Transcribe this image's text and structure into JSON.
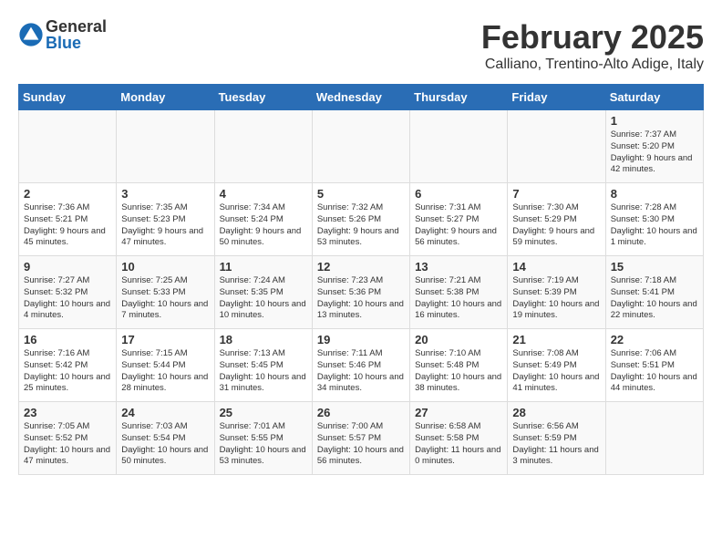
{
  "header": {
    "logo_general": "General",
    "logo_blue": "Blue",
    "month_year": "February 2025",
    "location": "Calliano, Trentino-Alto Adige, Italy"
  },
  "weekdays": [
    "Sunday",
    "Monday",
    "Tuesday",
    "Wednesday",
    "Thursday",
    "Friday",
    "Saturday"
  ],
  "weeks": [
    [
      {
        "day": "",
        "info": ""
      },
      {
        "day": "",
        "info": ""
      },
      {
        "day": "",
        "info": ""
      },
      {
        "day": "",
        "info": ""
      },
      {
        "day": "",
        "info": ""
      },
      {
        "day": "",
        "info": ""
      },
      {
        "day": "1",
        "info": "Sunrise: 7:37 AM\nSunset: 5:20 PM\nDaylight: 9 hours and 42 minutes."
      }
    ],
    [
      {
        "day": "2",
        "info": "Sunrise: 7:36 AM\nSunset: 5:21 PM\nDaylight: 9 hours and 45 minutes."
      },
      {
        "day": "3",
        "info": "Sunrise: 7:35 AM\nSunset: 5:23 PM\nDaylight: 9 hours and 47 minutes."
      },
      {
        "day": "4",
        "info": "Sunrise: 7:34 AM\nSunset: 5:24 PM\nDaylight: 9 hours and 50 minutes."
      },
      {
        "day": "5",
        "info": "Sunrise: 7:32 AM\nSunset: 5:26 PM\nDaylight: 9 hours and 53 minutes."
      },
      {
        "day": "6",
        "info": "Sunrise: 7:31 AM\nSunset: 5:27 PM\nDaylight: 9 hours and 56 minutes."
      },
      {
        "day": "7",
        "info": "Sunrise: 7:30 AM\nSunset: 5:29 PM\nDaylight: 9 hours and 59 minutes."
      },
      {
        "day": "8",
        "info": "Sunrise: 7:28 AM\nSunset: 5:30 PM\nDaylight: 10 hours and 1 minute."
      }
    ],
    [
      {
        "day": "9",
        "info": "Sunrise: 7:27 AM\nSunset: 5:32 PM\nDaylight: 10 hours and 4 minutes."
      },
      {
        "day": "10",
        "info": "Sunrise: 7:25 AM\nSunset: 5:33 PM\nDaylight: 10 hours and 7 minutes."
      },
      {
        "day": "11",
        "info": "Sunrise: 7:24 AM\nSunset: 5:35 PM\nDaylight: 10 hours and 10 minutes."
      },
      {
        "day": "12",
        "info": "Sunrise: 7:23 AM\nSunset: 5:36 PM\nDaylight: 10 hours and 13 minutes."
      },
      {
        "day": "13",
        "info": "Sunrise: 7:21 AM\nSunset: 5:38 PM\nDaylight: 10 hours and 16 minutes."
      },
      {
        "day": "14",
        "info": "Sunrise: 7:19 AM\nSunset: 5:39 PM\nDaylight: 10 hours and 19 minutes."
      },
      {
        "day": "15",
        "info": "Sunrise: 7:18 AM\nSunset: 5:41 PM\nDaylight: 10 hours and 22 minutes."
      }
    ],
    [
      {
        "day": "16",
        "info": "Sunrise: 7:16 AM\nSunset: 5:42 PM\nDaylight: 10 hours and 25 minutes."
      },
      {
        "day": "17",
        "info": "Sunrise: 7:15 AM\nSunset: 5:44 PM\nDaylight: 10 hours and 28 minutes."
      },
      {
        "day": "18",
        "info": "Sunrise: 7:13 AM\nSunset: 5:45 PM\nDaylight: 10 hours and 31 minutes."
      },
      {
        "day": "19",
        "info": "Sunrise: 7:11 AM\nSunset: 5:46 PM\nDaylight: 10 hours and 34 minutes."
      },
      {
        "day": "20",
        "info": "Sunrise: 7:10 AM\nSunset: 5:48 PM\nDaylight: 10 hours and 38 minutes."
      },
      {
        "day": "21",
        "info": "Sunrise: 7:08 AM\nSunset: 5:49 PM\nDaylight: 10 hours and 41 minutes."
      },
      {
        "day": "22",
        "info": "Sunrise: 7:06 AM\nSunset: 5:51 PM\nDaylight: 10 hours and 44 minutes."
      }
    ],
    [
      {
        "day": "23",
        "info": "Sunrise: 7:05 AM\nSunset: 5:52 PM\nDaylight: 10 hours and 47 minutes."
      },
      {
        "day": "24",
        "info": "Sunrise: 7:03 AM\nSunset: 5:54 PM\nDaylight: 10 hours and 50 minutes."
      },
      {
        "day": "25",
        "info": "Sunrise: 7:01 AM\nSunset: 5:55 PM\nDaylight: 10 hours and 53 minutes."
      },
      {
        "day": "26",
        "info": "Sunrise: 7:00 AM\nSunset: 5:57 PM\nDaylight: 10 hours and 56 minutes."
      },
      {
        "day": "27",
        "info": "Sunrise: 6:58 AM\nSunset: 5:58 PM\nDaylight: 11 hours and 0 minutes."
      },
      {
        "day": "28",
        "info": "Sunrise: 6:56 AM\nSunset: 5:59 PM\nDaylight: 11 hours and 3 minutes."
      },
      {
        "day": "",
        "info": ""
      }
    ]
  ]
}
